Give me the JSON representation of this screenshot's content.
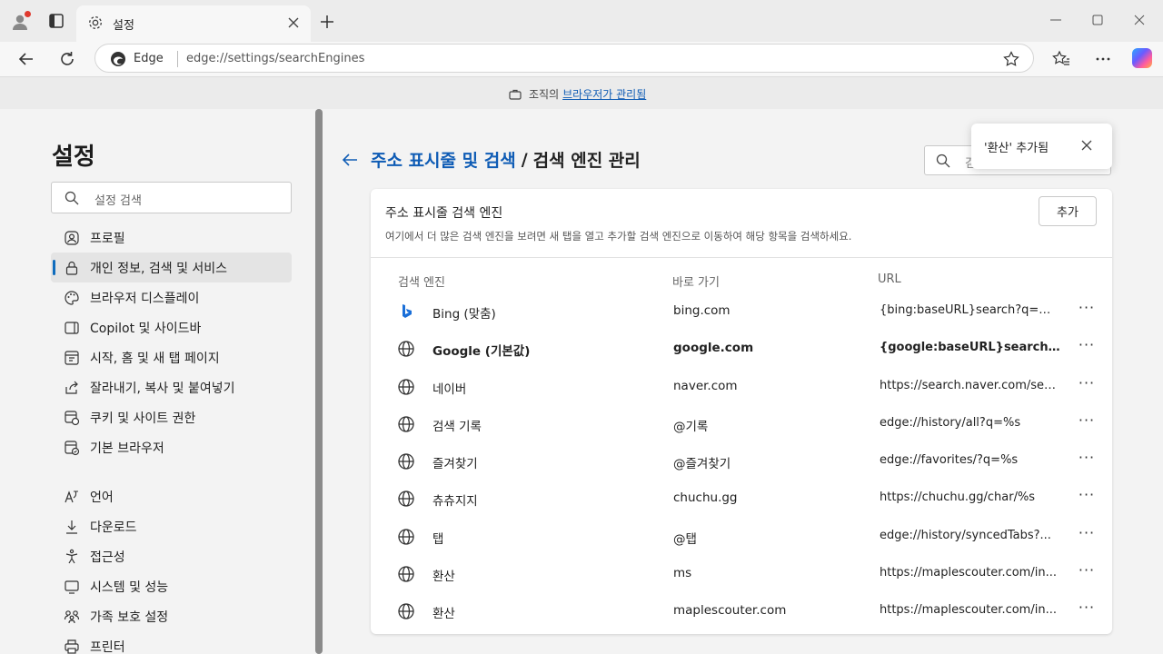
{
  "tab": {
    "title": "설정"
  },
  "address": {
    "site_label": "Edge",
    "url": "edge://settings/searchEngines"
  },
  "managed_bar": {
    "prefix": "조직의",
    "link": "브라우저가 관리됨"
  },
  "sidebar": {
    "title": "설정",
    "search_placeholder": "설정 검색",
    "items": [
      {
        "label": "프로필",
        "icon": "profile-icon"
      },
      {
        "label": "개인 정보, 검색 및 서비스",
        "icon": "lock-icon",
        "active": true
      },
      {
        "label": "브라우저 디스플레이",
        "icon": "palette-icon"
      },
      {
        "label": "Copilot 및 사이드바",
        "icon": "sidebar-icon"
      },
      {
        "label": "시작, 홈 및 새 탭 페이지",
        "icon": "home-icon"
      },
      {
        "label": "잘라내기, 복사 및 붙여넣기",
        "icon": "share-icon"
      },
      {
        "label": "쿠키 및 사이트 권한",
        "icon": "cookie-icon"
      },
      {
        "label": "기본 브라우저",
        "icon": "browser-icon"
      },
      {
        "label": "언어",
        "icon": "language-icon"
      },
      {
        "label": "다운로드",
        "icon": "download-icon"
      },
      {
        "label": "접근성",
        "icon": "accessibility-icon"
      },
      {
        "label": "시스템 및 성능",
        "icon": "system-icon"
      },
      {
        "label": "가족 보호 설정",
        "icon": "family-icon"
      },
      {
        "label": "프린터",
        "icon": "printer-icon"
      }
    ]
  },
  "breadcrumb": {
    "parent": "주소 표시줄 및 검색",
    "separator": "/",
    "current": "검색 엔진 관리"
  },
  "main_search": {
    "placeholder": "검"
  },
  "toast": {
    "message": "'환산' 추가됨"
  },
  "card": {
    "title": "주소 표시줄 검색 엔진",
    "description": "여기에서 더 많은 검색 엔진을 보려면 새 탭을 열고 추가할 검색 엔진으로 이동하여 해당 항목을 검색하세요.",
    "add_label": "추가",
    "columns": [
      "검색 엔진",
      "바로 가기",
      "URL"
    ],
    "rows": [
      {
        "name": "Bing (맞춤)",
        "shortcut": "bing.com",
        "url": "{bing:baseURL}search?q=%s...",
        "icon": "bing-icon"
      },
      {
        "name": "Google (기본값)",
        "shortcut": "google.com",
        "url": "{google:baseURL}search?q...",
        "icon": "globe-icon",
        "bold": true
      },
      {
        "name": "네이버",
        "shortcut": "naver.com",
        "url": "https://search.naver.com/sea...",
        "icon": "globe-icon"
      },
      {
        "name": "검색 기록",
        "shortcut": "@기록",
        "url": "edge://history/all?q=%s",
        "icon": "globe-icon"
      },
      {
        "name": "즐겨찾기",
        "shortcut": "@즐겨찾기",
        "url": "edge://favorites/?q=%s",
        "icon": "globe-icon"
      },
      {
        "name": "츄츄지지",
        "shortcut": "chuchu.gg",
        "url": "https://chuchu.gg/char/%s",
        "icon": "globe-icon"
      },
      {
        "name": "탭",
        "shortcut": "@탭",
        "url": "edge://history/syncedTabs?...",
        "icon": "globe-icon"
      },
      {
        "name": "환산",
        "shortcut": "ms",
        "url": "https://maplescouter.com/in...",
        "icon": "globe-icon"
      },
      {
        "name": "환산",
        "shortcut": "maplescouter.com",
        "url": "https://maplescouter.com/in...",
        "icon": "globe-icon"
      }
    ],
    "more_label": "···"
  },
  "colors": {
    "accent": "#0f6cbd",
    "link": "#0f5cb5"
  }
}
